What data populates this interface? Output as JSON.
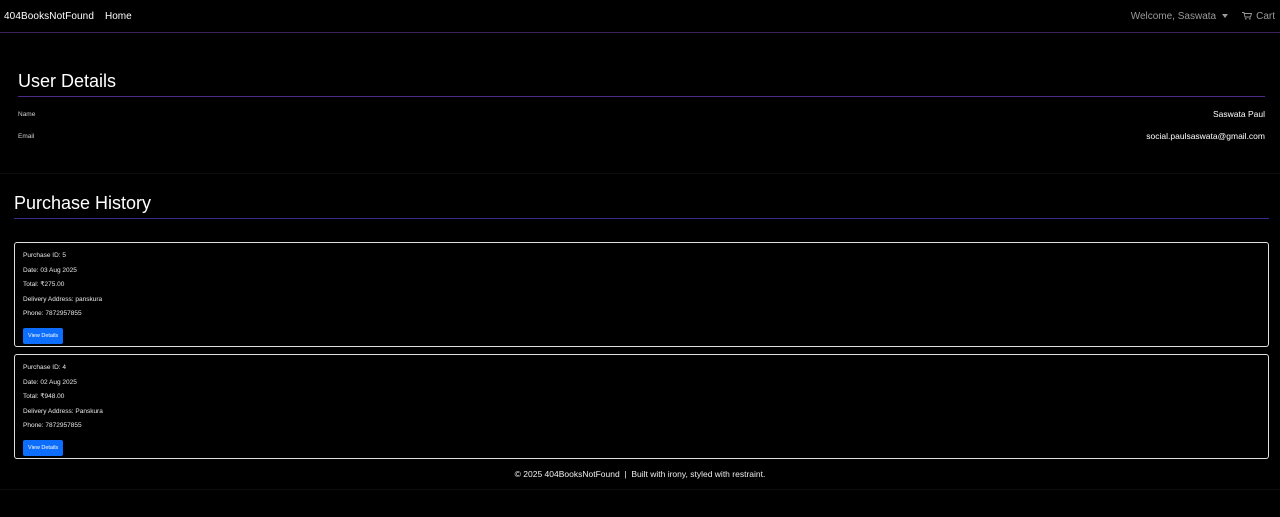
{
  "nav": {
    "brand": "404BooksNotFound",
    "home": "Home",
    "welcome": "Welcome, Saswata",
    "cart": "Cart"
  },
  "user": {
    "title": "User Details",
    "name_label": "Name",
    "name_value": "Saswata Paul",
    "email_label": "Email",
    "email_value": "social.paulsaswata@gmail.com"
  },
  "history": {
    "title": "Purchase History",
    "orders": [
      {
        "id": "Purchase ID: 5",
        "date": "Date: 03 Aug 2025",
        "total": "Total: ₹275.00",
        "address": "Delivery Address: panskura",
        "phone": "Phone: 7872957855",
        "button": "View Details"
      },
      {
        "id": "Purchase ID: 4",
        "date": "Date: 02 Aug 2025",
        "total": "Total: ₹948.00",
        "address": "Delivery Address: Panskura",
        "phone": "Phone: 7872957855",
        "button": "View Details"
      }
    ]
  },
  "footer": {
    "text": "© 2025 404BooksNotFound  |  Built with irony, styled with restraint."
  },
  "colors": {
    "background": "#000000",
    "accent": "#4b2a8a",
    "button": "#0d6efd"
  }
}
